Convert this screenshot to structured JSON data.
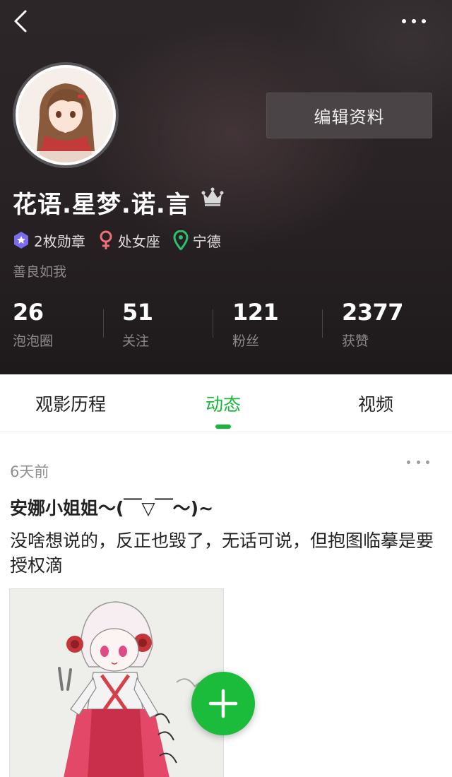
{
  "header": {
    "back_icon": "back-arrow-icon",
    "more_icon": "more-dots-icon",
    "edit_profile_label": "编辑资料"
  },
  "profile": {
    "name": "花语.星梦.诺.言",
    "crown_icon": "crown-icon",
    "badges": [
      {
        "icon": "medal-icon",
        "label": "2枚勋章",
        "color": "#7a6cf0"
      },
      {
        "icon": "female-icon",
        "label": "处女座",
        "color": "#f0707a"
      },
      {
        "icon": "location-pin-icon",
        "label": "宁德",
        "color": "#2bc26b"
      }
    ],
    "bio": "善良如我"
  },
  "stats": [
    {
      "value": "26",
      "label": "泡泡圈"
    },
    {
      "value": "51",
      "label": "关注"
    },
    {
      "value": "121",
      "label": "粉丝"
    },
    {
      "value": "2377",
      "label": "获赞"
    }
  ],
  "tabs": [
    {
      "label": "观影历程",
      "active": false
    },
    {
      "label": "动态",
      "active": true
    },
    {
      "label": "视频",
      "active": false
    }
  ],
  "post": {
    "time": "6天前",
    "title": "安娜小姐姐～(￣▽￣～)~",
    "body": "没啥想说的，反正也毁了，无话可说，但抱图临摹是要授权滴"
  },
  "fab": {
    "icon": "plus-icon"
  },
  "colors": {
    "accent_green": "#16b93a",
    "header_dark": "#2a2325"
  }
}
